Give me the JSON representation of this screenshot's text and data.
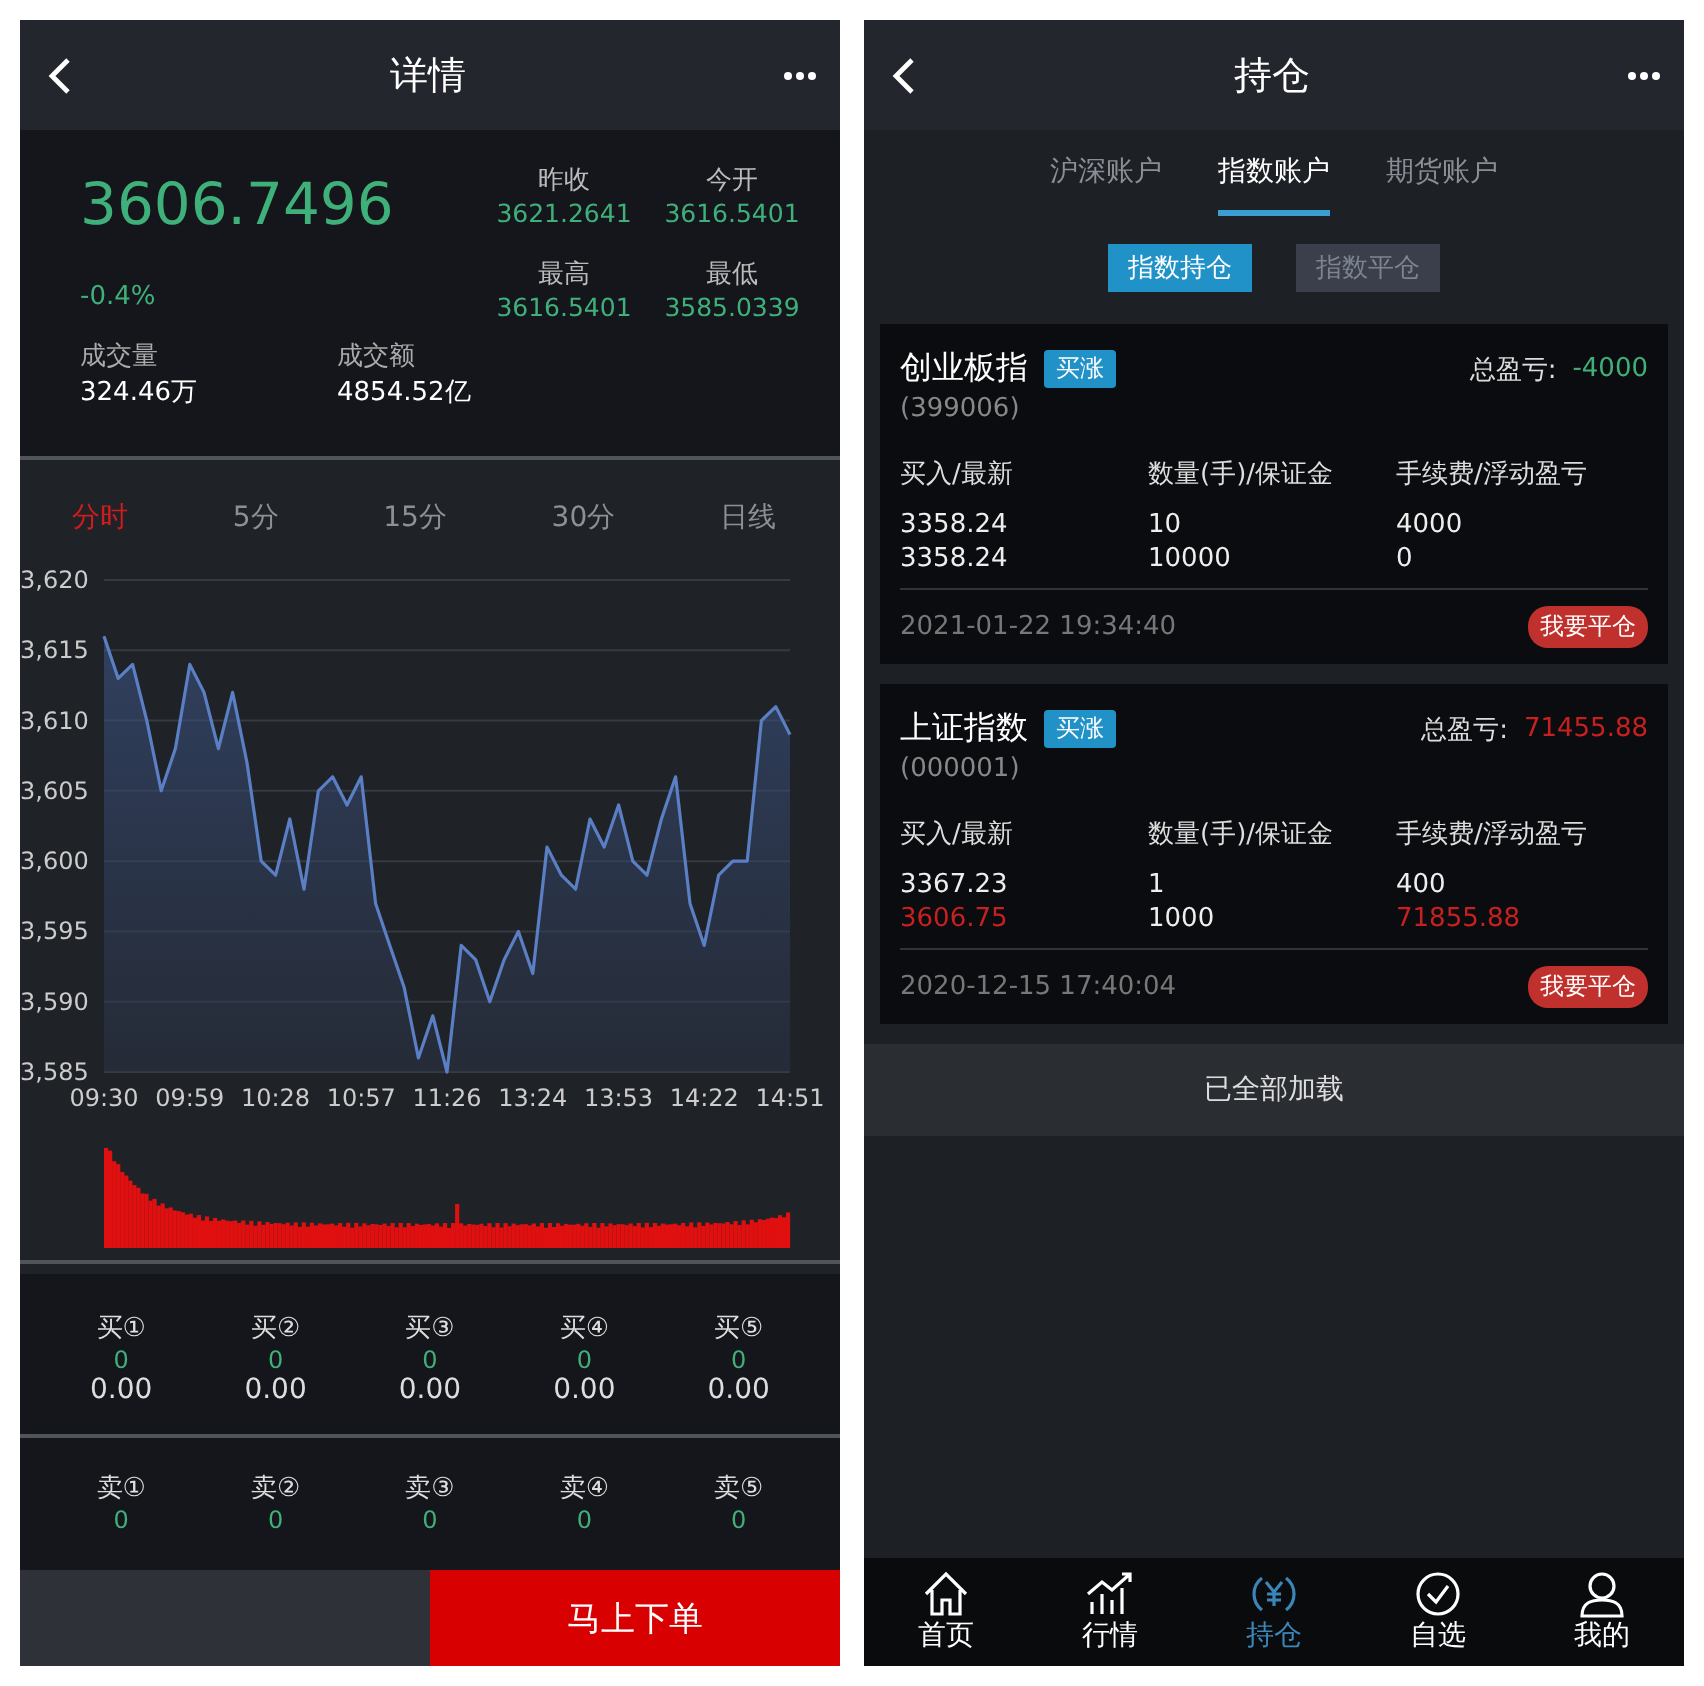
{
  "detail": {
    "title": "详情",
    "quote": {
      "price": "3606.7496",
      "change": "-0.4%"
    },
    "stats": [
      {
        "label": "昨收",
        "value": "3621.2641"
      },
      {
        "label": "今开",
        "value": "3616.5401"
      },
      {
        "label": "最高",
        "value": "3616.5401"
      },
      {
        "label": "最低",
        "value": "3585.0339"
      }
    ],
    "volume": [
      {
        "label": "成交量",
        "value": "324.46万"
      },
      {
        "label": "成交额",
        "value": "4854.52亿"
      }
    ],
    "periods": [
      {
        "label": "分时",
        "selected": true
      },
      {
        "label": "5分",
        "selected": false
      },
      {
        "label": "15分",
        "selected": false
      },
      {
        "label": "30分",
        "selected": false
      },
      {
        "label": "日线",
        "selected": false
      }
    ],
    "chart_data": {
      "type": "line",
      "categories": [
        "09:30",
        null,
        null,
        null,
        null,
        null,
        "09:59",
        null,
        null,
        null,
        null,
        null,
        "10:28",
        null,
        null,
        null,
        null,
        null,
        "10:57",
        null,
        null,
        null,
        null,
        null,
        "11:26",
        null,
        null,
        null,
        null,
        null,
        "13:24",
        null,
        null,
        null,
        null,
        null,
        "13:53",
        null,
        null,
        null,
        null,
        null,
        "14:22",
        null,
        null,
        null,
        null,
        null,
        "14:51"
      ],
      "series": [
        {
          "color": "#5a7fc4",
          "values": [
            3616,
            3613,
            3614,
            3610,
            3605,
            3608,
            3614,
            3612,
            3608,
            3612,
            3607,
            3600,
            3599,
            3603,
            3598,
            3605,
            3606,
            3604,
            3606,
            3597,
            3594,
            3591,
            3586,
            3589,
            3585,
            3594,
            3593,
            3590,
            3593,
            3595,
            3592,
            3601,
            3599,
            3598,
            3603,
            3601,
            3604,
            3600,
            3599,
            3603,
            3606,
            3597,
            3594,
            3599,
            3600,
            3600,
            3610,
            3611,
            3609
          ]
        }
      ],
      "ylim": [
        3585,
        3620
      ],
      "grid": true,
      "yticks": [
        {
          "value": 3620,
          "label": "3,620"
        },
        {
          "value": 3615,
          "label": "3,615"
        },
        {
          "value": 3610,
          "label": "3,610"
        },
        {
          "value": 3605,
          "label": "3,605"
        },
        {
          "value": 3600,
          "label": "3,600"
        },
        {
          "value": 3595,
          "label": "3,595"
        },
        {
          "value": 3590,
          "label": "3,590"
        },
        {
          "value": 3585,
          "label": "3,585"
        }
      ]
    },
    "buy": [
      {
        "label": "买①",
        "volume": "0",
        "price": "0.00"
      },
      {
        "label": "买②",
        "volume": "0",
        "price": "0.00"
      },
      {
        "label": "买③",
        "volume": "0",
        "price": "0.00"
      },
      {
        "label": "买④",
        "volume": "0",
        "price": "0.00"
      },
      {
        "label": "买⑤",
        "volume": "0",
        "price": "0.00"
      }
    ],
    "sell": [
      {
        "label": "卖①",
        "volume": "0"
      },
      {
        "label": "卖②",
        "volume": "0"
      },
      {
        "label": "卖③",
        "volume": "0"
      },
      {
        "label": "卖④",
        "volume": "0"
      },
      {
        "label": "卖⑤",
        "volume": "0"
      }
    ],
    "order_button": "马上下单"
  },
  "positions": {
    "title": "持仓",
    "accounts": [
      {
        "label": "沪深账户",
        "selected": false
      },
      {
        "label": "指数账户",
        "selected": true
      },
      {
        "label": "期货账户",
        "selected": false
      }
    ],
    "modes": [
      {
        "label": "指数持仓",
        "selected": true
      },
      {
        "label": "指数平仓",
        "selected": false
      }
    ],
    "cards": [
      {
        "name": "创业板指",
        "tag": "买涨",
        "code": "(399006)",
        "pnl_label": "总盈亏:",
        "pnl": {
          "text": "-4000",
          "color": "#3fb07a"
        },
        "columns": [
          "买入/最新",
          "数量(手)/保证金",
          "手续费/浮动盈亏"
        ],
        "rows": [
          [
            {
              "text": "3358.24",
              "color": "#eeeeee"
            },
            {
              "text": "10",
              "color": "#eeeeee"
            },
            {
              "text": "4000",
              "color": "#eeeeee"
            }
          ],
          [
            {
              "text": "3358.24",
              "color": "#eeeeee"
            },
            {
              "text": "10000",
              "color": "#eeeeee"
            },
            {
              "text": "0",
              "color": "#eeeeee"
            }
          ]
        ],
        "time": "2021-01-22 19:34:40",
        "close_button": "我要平仓"
      },
      {
        "name": "上证指数",
        "tag": "买涨",
        "code": "(000001)",
        "pnl_label": "总盈亏:",
        "pnl": {
          "text": "71455.88",
          "color": "#c62020"
        },
        "columns": [
          "买入/最新",
          "数量(手)/保证金",
          "手续费/浮动盈亏"
        ],
        "rows": [
          [
            {
              "text": "3367.23",
              "color": "#eeeeee"
            },
            {
              "text": "1",
              "color": "#eeeeee"
            },
            {
              "text": "400",
              "color": "#eeeeee"
            }
          ],
          [
            {
              "text": "3606.75",
              "color": "#c62020"
            },
            {
              "text": "1000",
              "color": "#eeeeee"
            },
            {
              "text": "71855.88",
              "color": "#c62020"
            }
          ]
        ],
        "time": "2020-12-15 17:40:04",
        "close_button": "我要平仓"
      }
    ],
    "loaded_all": "已全部加载",
    "nav": [
      {
        "label": "首页",
        "kind": "home",
        "selected": false
      },
      {
        "label": "行情",
        "kind": "chart",
        "selected": false
      },
      {
        "label": "持仓",
        "kind": "yen",
        "selected": true
      },
      {
        "label": "自选",
        "kind": "check",
        "selected": false
      },
      {
        "label": "我的",
        "kind": "user",
        "selected": false
      }
    ]
  }
}
